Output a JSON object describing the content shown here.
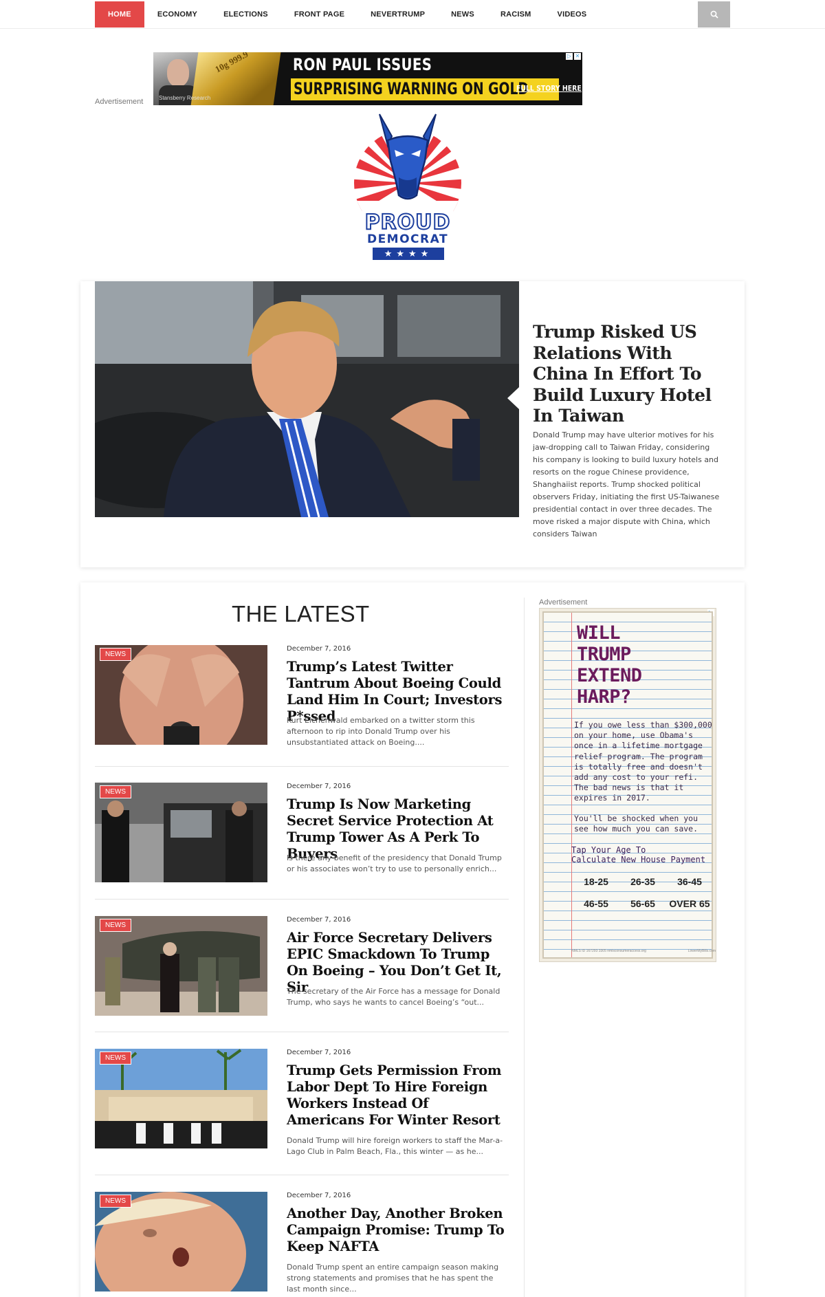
{
  "nav": {
    "items": [
      "HOME",
      "ECONOMY",
      "ELECTIONS",
      "FRONT PAGE",
      "NEVERTRUMP",
      "NEWS",
      "RACISM",
      "VIDEOS"
    ],
    "active": "HOME"
  },
  "top_ad": {
    "label": "Advertisement",
    "gold_text": "10g 999.9",
    "line1": "RON PAUL ISSUES",
    "line2": "SURPRISING WARNING ON GOLD",
    "cta": "FULL STORY HERE",
    "sponsor": "Stansberry Research"
  },
  "logo": {
    "line1": "PROUD",
    "line2": "DEMOCRAT",
    "stars": "★★★★"
  },
  "feature": {
    "title": "Trump Risked US Relations With China In Effort To Build Luxury Hotel In Taiwan",
    "excerpt": "Donald Trump may have ulterior motives for his jaw-dropping call to Taiwan Friday, considering his company is looking to build luxury hotels and resorts on the rogue Chinese providence, Shanghaiist reports. Trump shocked political observers Friday, initiating the first US-Taiwanese presidential contact in over three decades. The move risked a major dispute with China, which considers Taiwan"
  },
  "latest": {
    "heading": "THE LATEST",
    "articles": [
      {
        "badge": "NEWS",
        "date": "December 7, 2016",
        "title": "Trump’s Latest Twitter Tantrum About Boeing Could Land Him In Court; Investors P*ssed",
        "excerpt": "Kurt Eichenwald embarked on a twitter storm this afternoon to rip into Donald Trump over his unsubstantiated attack on Boeing...."
      },
      {
        "badge": "NEWS",
        "date": "December 7, 2016",
        "title": "Trump Is Now Marketing Secret Service Protection At Trump Tower As A Perk To Buyers",
        "excerpt": "Is there any benefit of the presidency that Donald Trump or his associates won’t try to use to personally enrich..."
      },
      {
        "badge": "NEWS",
        "date": "December 7, 2016",
        "title": "Air Force Secretary Delivers EPIC Smackdown To Trump On Boeing – You Don’t Get It, Sir",
        "excerpt": "The secretary of the Air Force has a message for Donald Trump, who says he wants to cancel Boeing’s “out..."
      },
      {
        "badge": "NEWS",
        "date": "December 7, 2016",
        "title": "Trump Gets Permission From Labor Dept To Hire Foreign Workers Instead Of Americans For Winter Resort",
        "excerpt": "Donald Trump will hire foreign workers to staff the Mar-a-Lago Club in Palm Beach, Fla., this winter — as he..."
      },
      {
        "badge": "NEWS",
        "date": "December 7, 2016",
        "title": "Another Day, Another Broken Campaign Promise: Trump To Keep NAFTA",
        "excerpt": "Donald Trump spent an entire campaign season making strong statements and promises that he has spent the last month since..."
      }
    ]
  },
  "side_ad": {
    "label": "Advertisement",
    "headline": [
      "WILL",
      "TRUMP",
      "EXTEND",
      "HARP?"
    ],
    "body1": "If you owe less than $300,000 on your home, use Obama's once in a lifetime mortgage relief program. The program is totally free and doesn't add any cost to your refi. The bad news is that it expires in 2017.",
    "body2": "You'll be shocked when you see how much you can save.",
    "tap": [
      "Tap Your Age To",
      "Calculate New House Payment"
    ],
    "ages": [
      "18-25",
      "26-35",
      "36-45",
      "46-55",
      "56-65",
      "OVER 65"
    ],
    "foot_left": "NMLS ID 167293 3305 nmlsconsumeraccess.org",
    "foot_right": "LowerMyBills.com"
  },
  "colors": {
    "accent": "#e34848",
    "logo_blue": "#1d3f9e",
    "ad_yellow": "#f4d21f"
  }
}
